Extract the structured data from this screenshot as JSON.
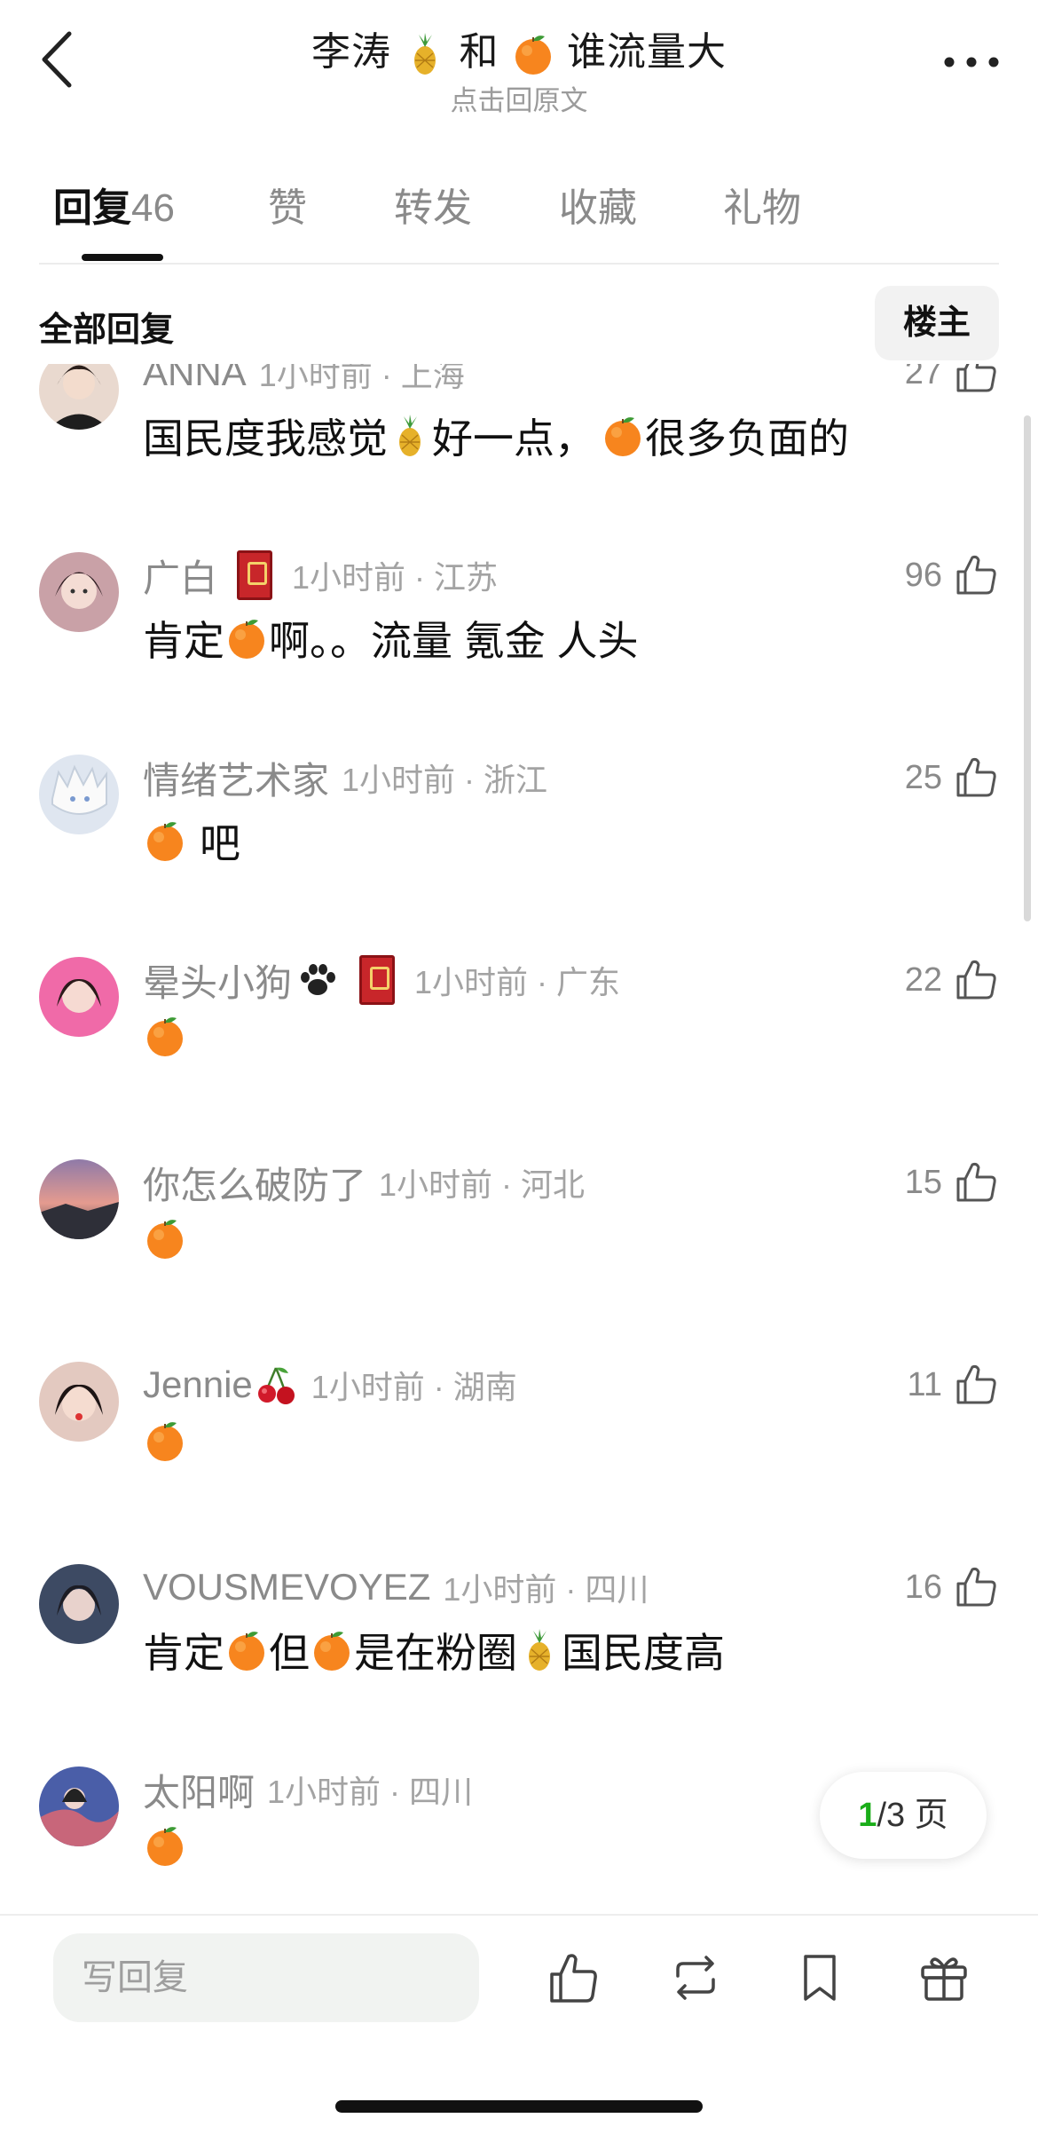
{
  "header": {
    "title_parts": [
      "李涛 ",
      " 和 ",
      " 谁流量大"
    ],
    "subtitle": "点击回原文",
    "title_icons": [
      "pineapple-emoji",
      "orange-emoji"
    ]
  },
  "tabs": [
    {
      "label": "回复",
      "count": "46",
      "active": true
    },
    {
      "label": "赞"
    },
    {
      "label": "转发"
    },
    {
      "label": "收藏"
    },
    {
      "label": "礼物"
    }
  ],
  "section": {
    "title": "全部回复",
    "filter_button": "楼主"
  },
  "comments": [
    {
      "name": "ANNA",
      "meta": "1小时前 · 上海",
      "likes": "27",
      "body_parts": [
        "国民度我感觉",
        "好一点，",
        "很多负面的"
      ]
    },
    {
      "name": "广白",
      "meta": "1小时前 · 江苏",
      "likes": "96",
      "has_badge": true,
      "body_parts": [
        "肯定",
        "啊。。流量 氪金 人头"
      ]
    },
    {
      "name": "情绪艺术家",
      "meta": "1小时前 · 浙江",
      "likes": "25",
      "body_parts": [
        "",
        "吧"
      ]
    },
    {
      "name": "晕头小狗",
      "meta": "1小时前 · 广东",
      "likes": "22",
      "has_badge": true,
      "name_icon": "paw-icon",
      "body_parts": [
        ""
      ]
    },
    {
      "name": "你怎么破防了",
      "meta": "1小时前 · 河北",
      "likes": "15",
      "body_parts": [
        ""
      ]
    },
    {
      "name": "Jennie",
      "meta": "1小时前 · 湖南",
      "likes": "11",
      "name_icon": "cherry-emoji",
      "body_parts": [
        ""
      ]
    },
    {
      "name": "VOUSMEVOYEZ",
      "meta": "1小时前 · 四川",
      "likes": "16",
      "body_parts": [
        "肯定",
        " 但",
        "是在粉圈 ",
        " 国民度高"
      ]
    },
    {
      "name": "太阳啊",
      "meta": "1小时前 · 四川",
      "likes": "",
      "body_parts": [
        ""
      ]
    }
  ],
  "pagination": {
    "current": "1",
    "total_text": "/3 页"
  },
  "bottom_bar": {
    "reply_placeholder": "写回复",
    "icons": [
      "like-icon",
      "repost-icon",
      "bookmark-icon",
      "gift-icon"
    ]
  },
  "colors": {
    "accent_green": "#1aad19",
    "text_gray": "#8a8a8a",
    "orange": "#f58220",
    "pineapple": "#e7b22c"
  }
}
